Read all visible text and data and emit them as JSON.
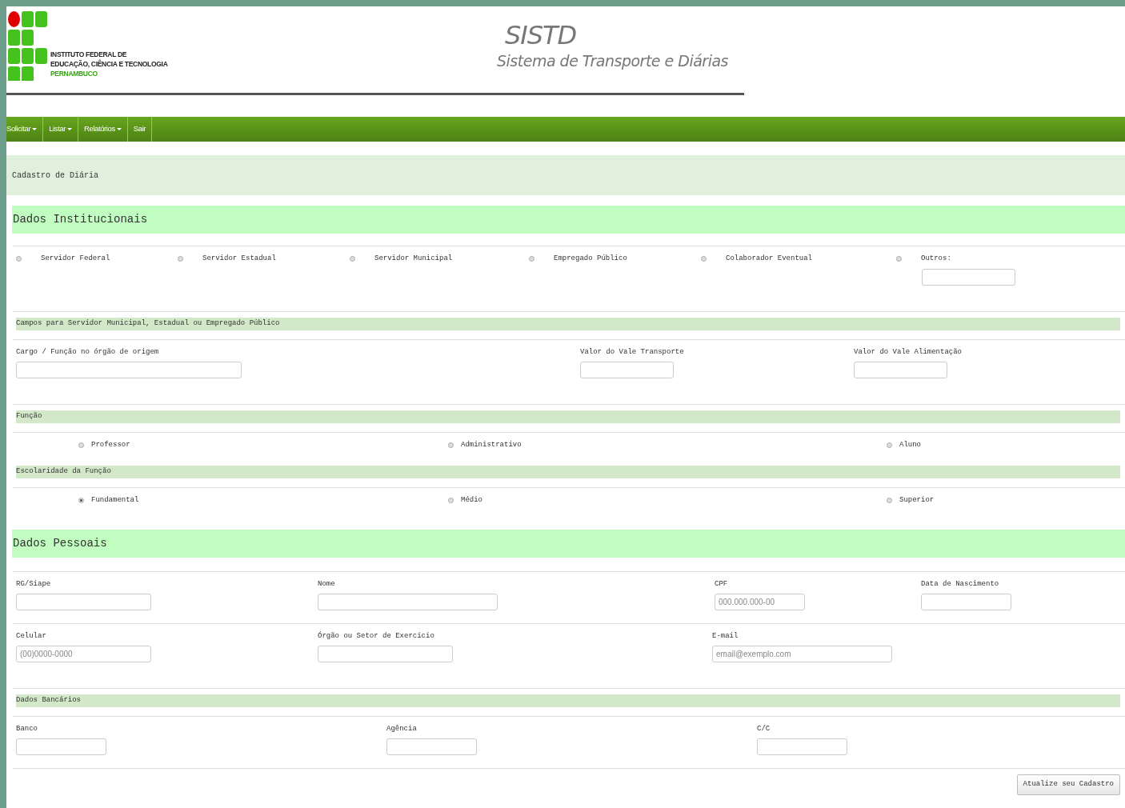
{
  "header": {
    "logo_lines": [
      "INSTITUTO FEDERAL DE",
      "EDUCAÇÃO, CIÊNCIA E TECNOLOGIA",
      "PERNAMBUCO"
    ],
    "title": "SISTD",
    "subtitle": "Sistema de Transporte e Diárias"
  },
  "navbar": {
    "items": [
      {
        "label": "Solicitar",
        "dropdown": true
      },
      {
        "label": "Listar",
        "dropdown": true
      },
      {
        "label": "Relatórios",
        "dropdown": true
      },
      {
        "label": "Sair",
        "dropdown": false
      }
    ]
  },
  "page_title": "Cadastro de Diária",
  "dados_institucionais": {
    "heading": "Dados Institucionais",
    "options": [
      {
        "label": "Servidor Federal",
        "selected": false,
        "kind": "radio"
      },
      {
        "label": "Servidor Estadual",
        "selected": false,
        "kind": "radio"
      },
      {
        "label": "Servidor Municipal",
        "selected": false,
        "kind": "radio"
      },
      {
        "label": "Empregado Público",
        "selected": false,
        "kind": "radio"
      },
      {
        "label": "Colaborador Eventual",
        "selected": false,
        "kind": "radio"
      },
      {
        "label": "Outros:",
        "selected": false,
        "kind": "radio-field"
      }
    ]
  },
  "campos_servidor": {
    "heading": "Campos para Servidor Municipal, Estadual ou Empregado Público",
    "fields": [
      {
        "label": "Cargo / Função no órgão de origem"
      },
      {
        "label": "Valor do Vale Transporte"
      },
      {
        "label": "Valor do Vale Alimentação"
      }
    ]
  },
  "funcao": {
    "heading": "Função",
    "options": [
      {
        "label": "Professor",
        "selected": false
      },
      {
        "label": "Administrativo",
        "selected": false
      },
      {
        "label": "Aluno",
        "selected": false
      }
    ]
  },
  "escolaridade": {
    "heading": "Escolaridade da Função",
    "options": [
      {
        "label": "Fundamental",
        "selected": true
      },
      {
        "label": "Médio",
        "selected": false
      },
      {
        "label": "Superior",
        "selected": false
      }
    ]
  },
  "dados_pessoais": {
    "heading": "Dados Pessoais",
    "rows": [
      [
        {
          "label": "RG/Siape"
        },
        {
          "label": "Nome"
        },
        {
          "label": "CPF",
          "placeholder": "000.000.000-00"
        },
        {
          "label": "Data de Nascimento"
        }
      ],
      [
        {
          "label": "Celular",
          "placeholder": "(00)0000-0000"
        },
        {
          "label": "Órgão ou Setor de Exercício"
        },
        {
          "label": "E-mail",
          "placeholder": "email@exemplo.com"
        }
      ]
    ]
  },
  "dados_bancarios": {
    "heading": "Dados Bancários",
    "fields": [
      {
        "label": "Banco"
      },
      {
        "label": "Agência"
      },
      {
        "label": "C/C"
      }
    ]
  },
  "submit_button": "Atualize seu Cadastro"
}
